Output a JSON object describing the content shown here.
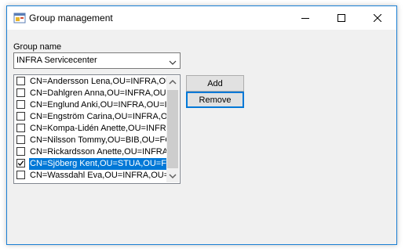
{
  "window": {
    "title": "Group management",
    "icons": {
      "app": "app-form-icon",
      "minimize": "minimize-icon",
      "maximize": "maximize-icon",
      "close": "close-icon"
    }
  },
  "group": {
    "label": "Group name",
    "selected": "INFRA Servicecenter"
  },
  "members": [
    {
      "text": "CN=Andersson Lena,OU=INFRA,OU",
      "checked": false,
      "selected": false
    },
    {
      "text": "CN=Dahlgren Anna,OU=INFRA,OU",
      "checked": false,
      "selected": false
    },
    {
      "text": "CN=Englund Anki,OU=INFRA,OU=I",
      "checked": false,
      "selected": false
    },
    {
      "text": "CN=Engström Carina,OU=INFRA,OU",
      "checked": false,
      "selected": false
    },
    {
      "text": "CN=Kompa-Lidén Anette,OU=INFR",
      "checked": false,
      "selected": false
    },
    {
      "text": "CN=Nilsson Tommy,OU=BIB,OU=FC",
      "checked": false,
      "selected": false
    },
    {
      "text": "CN=Rickardsson Anette,OU=INFRA",
      "checked": false,
      "selected": false
    },
    {
      "text": "CN=Sjöberg Kent,OU=STUA,OU=F",
      "checked": true,
      "selected": true
    },
    {
      "text": "CN=Wassdahl Eva,OU=INFRA,OU=",
      "checked": false,
      "selected": false
    }
  ],
  "buttons": {
    "add": "Add",
    "remove": "Remove"
  },
  "colors": {
    "accent": "#0078d7",
    "selection": "#0078d7",
    "window_border": "#1a7fd4",
    "background": "#f0f0f0"
  }
}
